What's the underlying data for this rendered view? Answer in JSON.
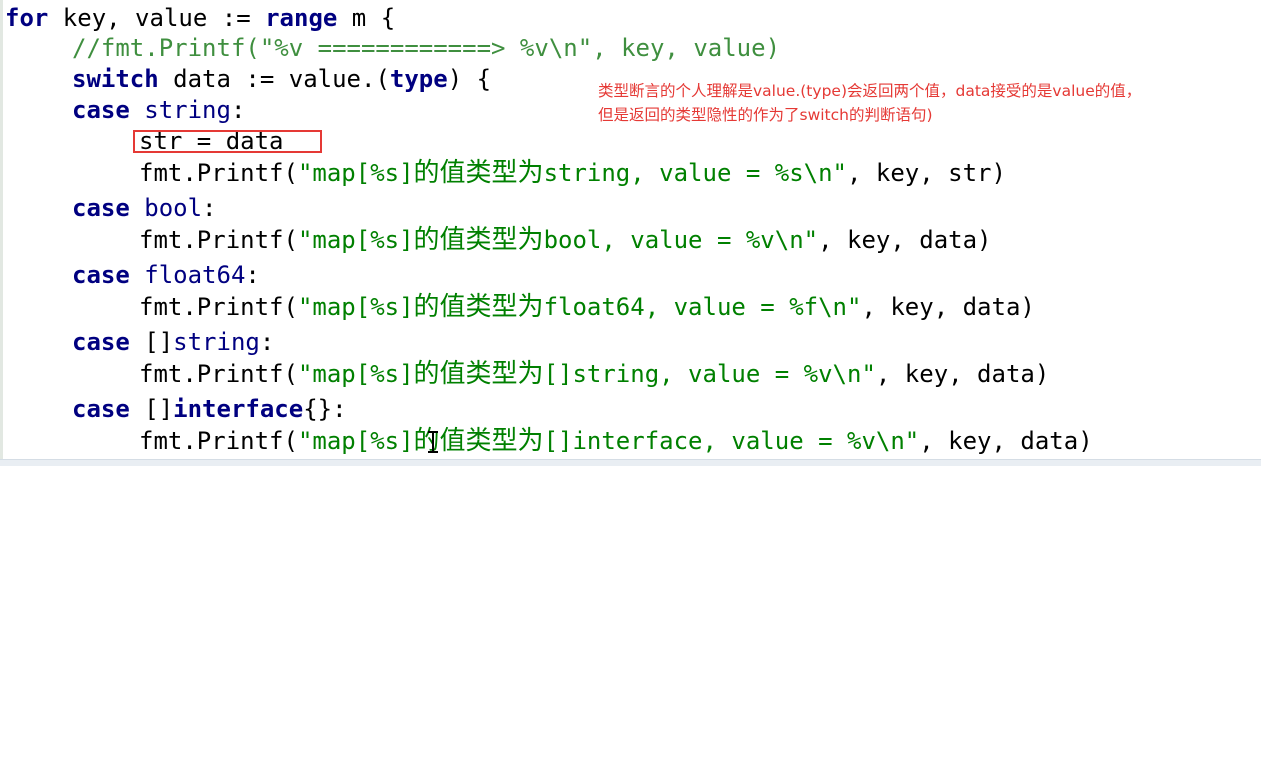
{
  "code": {
    "l1_kw": "for",
    "l1_rest": " key, value := ",
    "l1_kw2": "range",
    "l1_tail": " m {",
    "l2_comment": "//fmt.Printf(\"%v ============> %v\\n\", key, value)",
    "l3_kw": "switch",
    "l3_mid": " data := value.(",
    "l3_kw2": "type",
    "l3_tail": ") {",
    "l4_kw": "case",
    "l4_type": " string",
    "l4_colon": ":",
    "l5_text": "str = data",
    "l6_pre": "fmt.Printf(",
    "l6_str1": "\"map[%s]",
    "l6_cn": "的值类型为",
    "l6_str2": "string, value = %s\\n\"",
    "l6_tail": ", key, str)",
    "l7_kw": "case",
    "l7_type": " bool",
    "l7_colon": ":",
    "l8_pre": "fmt.Printf(",
    "l8_str1": "\"map[%s]",
    "l8_cn": "的值类型为",
    "l8_str2": "bool, value = %v\\n\"",
    "l8_tail": ", key, data)",
    "l9_kw": "case",
    "l9_type": " float64",
    "l9_colon": ":",
    "l10_pre": "fmt.Printf(",
    "l10_str1": "\"map[%s]",
    "l10_cn": "的值类型为",
    "l10_str2": "float64, value = %f\\n\"",
    "l10_tail": ", key, data)",
    "l11_kw": "case",
    "l11_br": " []",
    "l11_type": "string",
    "l11_colon": ":",
    "l12_pre": "fmt.Printf(",
    "l12_str1": "\"map[%s]",
    "l12_cn": "的值类型为",
    "l12_str2": "[]string, value = %v\\n\"",
    "l12_tail": ", key, data)",
    "l13_kw": "case",
    "l13_br": " []",
    "l13_kw2": "interface",
    "l13_tail": "{}:",
    "l14_pre": "fmt.Printf(",
    "l14_str1": "\"map[%s]",
    "l14_cn": "的值类型为",
    "l14_str2": "[]interface, value = %v\\n\"",
    "l14_tail": ", key, data)"
  },
  "annotation": {
    "line1": "类型断言的个人理解是value.(type)会返回两个值，data接受的是value的值，",
    "line2": "但是返回的类型隐性的作为了switch的判断语句)"
  },
  "colors": {
    "keyword": "#000080",
    "string": "#008000",
    "comment": "#3f8f3f",
    "annotation": "#e53935",
    "highlight_border": "#e53935"
  },
  "icons": {
    "cursor": "text-cursor-ibeam-icon"
  }
}
